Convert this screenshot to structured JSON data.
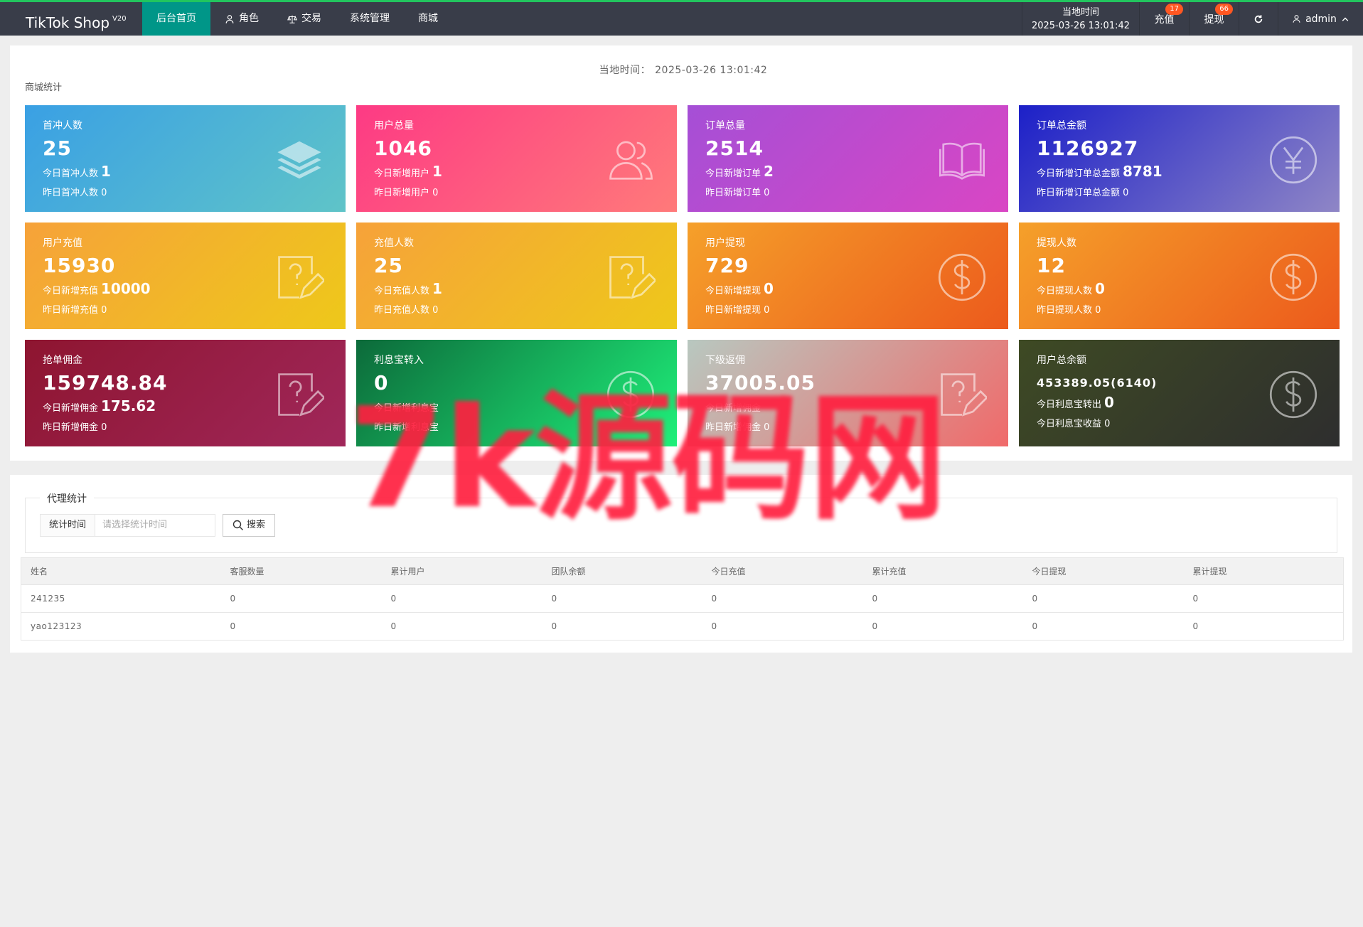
{
  "app": {
    "title": "TikTok Shop",
    "version": "V20"
  },
  "nav": [
    {
      "label": "后台首页",
      "icon": "",
      "active": true
    },
    {
      "label": "角色",
      "icon": "user-icon",
      "active": false
    },
    {
      "label": "交易",
      "icon": "scale-icon",
      "active": false
    },
    {
      "label": "系统管理",
      "icon": "",
      "active": false
    },
    {
      "label": "商城",
      "icon": "",
      "active": false
    }
  ],
  "header": {
    "time_label": "当地时间",
    "time_value": "2025-03-26 13:01:42",
    "charge_label": "充值",
    "charge_badge": "17",
    "withdraw_label": "提现",
    "withdraw_badge": "66",
    "user": "admin"
  },
  "stats": {
    "local_time_label": "当地时间：",
    "local_time_value": "2025-03-26 13:01:42",
    "section_title": "商城统计",
    "cards": [
      {
        "title": "首冲人数",
        "value": "25",
        "line1_label": "今日首冲人数",
        "line1_value": "1",
        "line2": "昨日首冲人数 0",
        "icon": "layers-icon"
      },
      {
        "title": "用户总量",
        "value": "1046",
        "line1_label": "今日新增用户",
        "line1_value": "1",
        "line2": "昨日新增用户 0",
        "icon": "users-icon"
      },
      {
        "title": "订单总量",
        "value": "2514",
        "line1_label": "今日新增订单",
        "line1_value": "2",
        "line2": "昨日新增订单 0",
        "icon": "book-icon"
      },
      {
        "title": "订单总金额",
        "value": "1126927",
        "line1_label": "今日新增订单总金额",
        "line1_value": "8781",
        "line2": "昨日新增订单总金额 0",
        "icon": "yen-icon"
      },
      {
        "title": "用户充值",
        "value": "15930",
        "line1_label": "今日新增充值",
        "line1_value": "10000",
        "line2": "昨日新增充值 0",
        "icon": "edit-question-icon"
      },
      {
        "title": "充值人数",
        "value": "25",
        "line1_label": "今日充值人数",
        "line1_value": "1",
        "line2": "昨日充值人数 0",
        "icon": "edit-question-icon"
      },
      {
        "title": "用户提现",
        "value": "729",
        "line1_label": "今日新增提现",
        "line1_value": "0",
        "line2": "昨日新增提现 0",
        "icon": "dollar-icon"
      },
      {
        "title": "提现人数",
        "value": "12",
        "line1_label": "今日提现人数",
        "line1_value": "0",
        "line2": "昨日提现人数 0",
        "icon": "dollar-icon"
      },
      {
        "title": "抢单佣金",
        "value": "159748.84",
        "line1_label": "今日新增佣金",
        "line1_value": "175.62",
        "line2": "昨日新增佣金 0",
        "icon": "edit-question-icon"
      },
      {
        "title": "利息宝转入",
        "value": "0",
        "line1_label": "今日新增利息宝",
        "line1_value": "",
        "line2": "昨日新增利息宝",
        "icon": "dollar-icon"
      },
      {
        "title": "下级返佣",
        "value": "37005.05",
        "line1_label": "今日新增佣金",
        "line1_value": "",
        "line2": "昨日新增佣金 0",
        "icon": "edit-question-icon"
      },
      {
        "title": "用户总余额",
        "value": "453389.05(6140)",
        "line1_label": "今日利息宝转出",
        "line1_value": "0",
        "line2": "今日利息宝收益 0",
        "icon": "dollar-icon"
      }
    ]
  },
  "agent": {
    "legend": "代理统计",
    "filter_label": "统计时间",
    "filter_placeholder": "请选择统计时间",
    "search_label": "搜索",
    "columns": [
      "姓名",
      "客服数量",
      "累计用户",
      "团队余额",
      "今日充值",
      "累计充值",
      "今日提现",
      "累计提现"
    ],
    "rows": [
      [
        "241235",
        "0",
        "0",
        "0",
        "0",
        "0",
        "0",
        "0"
      ],
      [
        "yao123123",
        "0",
        "0",
        "0",
        "0",
        "0",
        "0",
        "0"
      ]
    ]
  },
  "watermark": "7k源码网"
}
